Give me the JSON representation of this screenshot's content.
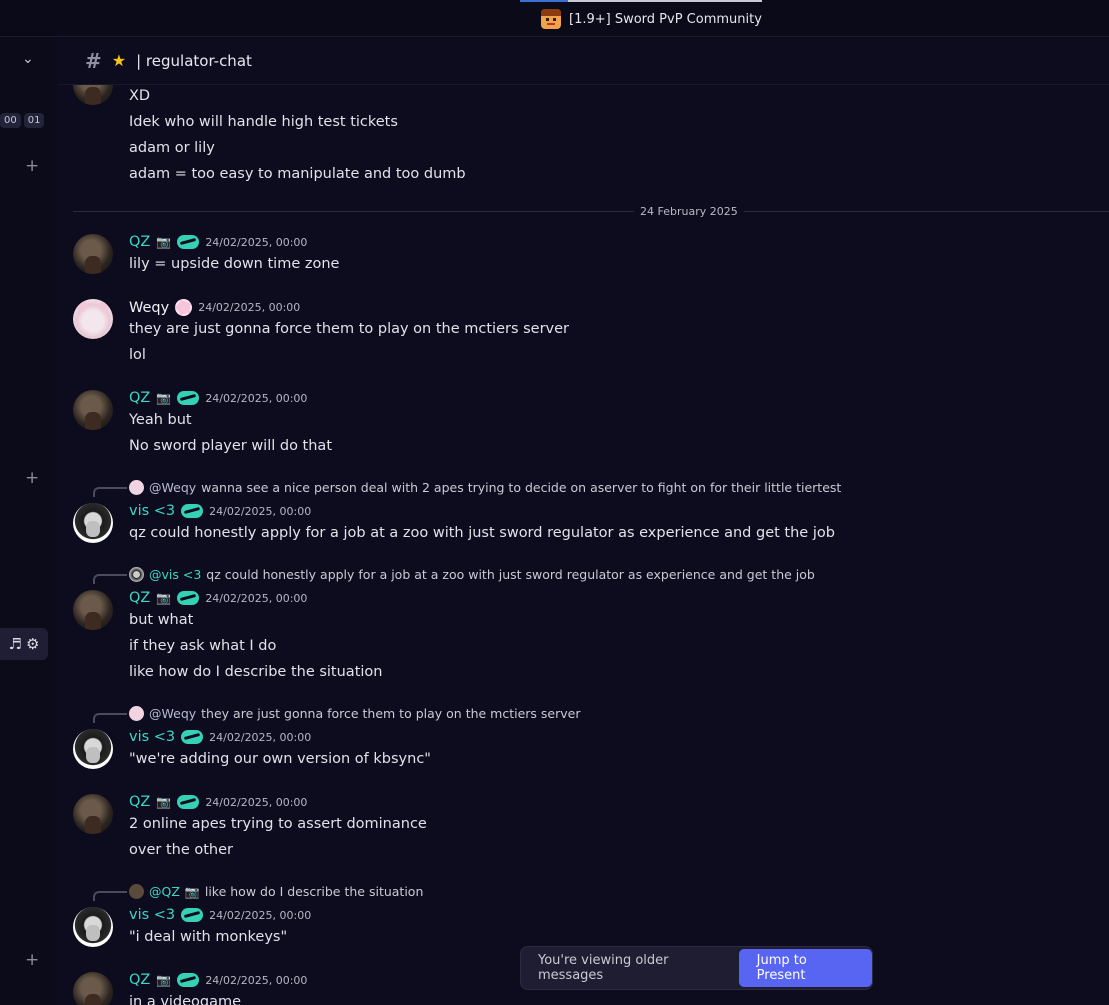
{
  "window": {
    "server_name": "[1.9+] Sword PvP Community"
  },
  "sidebar": {
    "badges": [
      "00",
      "01"
    ]
  },
  "channel": {
    "name": "| regulator-chat"
  },
  "messages": {
    "earlier_lines": [
      "XD",
      "Idek who will handle high test tickets",
      "adam or lily",
      "adam = too easy to manipulate and too dumb"
    ],
    "date_divider": "24 February 2025",
    "items": [
      {
        "author": "QZ",
        "timestamp": "24/02/2025, 00:00",
        "lines": [
          "lily = upside down time zone"
        ]
      },
      {
        "author": "Weqy",
        "timestamp": "24/02/2025, 00:00",
        "lines": [
          "they are just gonna force them to play on the mctiers server",
          "lol"
        ]
      },
      {
        "author": "QZ",
        "timestamp": "24/02/2025, 00:00",
        "lines": [
          "Yeah but",
          "No sword player will do that"
        ]
      },
      {
        "reply": {
          "mention": "@Weqy",
          "text": "wanna see a nice person deal with 2 apes trying to decide on aserver to fight on for their little tiertest"
        },
        "author": "vis <3",
        "timestamp": "24/02/2025, 00:00",
        "lines": [
          "qz could honestly apply for a job at a zoo with just sword regulator as experience and get the job"
        ]
      },
      {
        "reply": {
          "mention": "@vis <3",
          "text": "qz could honestly apply for a job at a zoo with just sword regulator as experience and get the job"
        },
        "author": "QZ",
        "timestamp": "24/02/2025, 00:00",
        "lines": [
          "but what",
          "if they ask what I do",
          "like how do I describe the situation"
        ]
      },
      {
        "reply": {
          "mention": "@Weqy",
          "text": "they are just gonna force them to play on the mctiers server"
        },
        "author": "vis <3",
        "timestamp": "24/02/2025, 00:00",
        "lines": [
          "\"we're adding our own version of kbsync\""
        ]
      },
      {
        "author": "QZ",
        "timestamp": "24/02/2025, 00:00",
        "lines": [
          "2 online apes trying to assert dominance",
          "over the other"
        ]
      },
      {
        "reply": {
          "mention": "@QZ",
          "text": "like how do I describe the situation"
        },
        "author": "vis <3",
        "timestamp": "24/02/2025, 00:00",
        "lines": [
          "\"i deal with monkeys\""
        ]
      },
      {
        "author": "QZ",
        "timestamp": "24/02/2025, 00:00",
        "lines": [
          "in a videogame"
        ]
      }
    ]
  },
  "jump_bar": {
    "info": "You're viewing older messages",
    "button": "Jump to Present"
  },
  "colors": {
    "accent": "#5865f2",
    "username_teal": "#3ad8c5",
    "background": "#0d0c1e"
  }
}
